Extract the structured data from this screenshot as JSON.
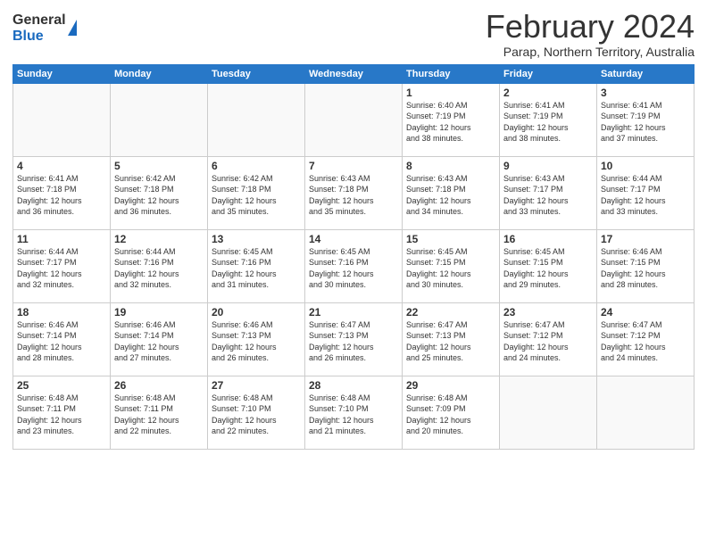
{
  "logo": {
    "general": "General",
    "blue": "Blue"
  },
  "header": {
    "title": "February 2024",
    "subtitle": "Parap, Northern Territory, Australia"
  },
  "weekdays": [
    "Sunday",
    "Monday",
    "Tuesday",
    "Wednesday",
    "Thursday",
    "Friday",
    "Saturday"
  ],
  "weeks": [
    [
      {
        "day": "",
        "info": ""
      },
      {
        "day": "",
        "info": ""
      },
      {
        "day": "",
        "info": ""
      },
      {
        "day": "",
        "info": ""
      },
      {
        "day": "1",
        "info": "Sunrise: 6:40 AM\nSunset: 7:19 PM\nDaylight: 12 hours\nand 38 minutes."
      },
      {
        "day": "2",
        "info": "Sunrise: 6:41 AM\nSunset: 7:19 PM\nDaylight: 12 hours\nand 38 minutes."
      },
      {
        "day": "3",
        "info": "Sunrise: 6:41 AM\nSunset: 7:19 PM\nDaylight: 12 hours\nand 37 minutes."
      }
    ],
    [
      {
        "day": "4",
        "info": "Sunrise: 6:41 AM\nSunset: 7:18 PM\nDaylight: 12 hours\nand 36 minutes."
      },
      {
        "day": "5",
        "info": "Sunrise: 6:42 AM\nSunset: 7:18 PM\nDaylight: 12 hours\nand 36 minutes."
      },
      {
        "day": "6",
        "info": "Sunrise: 6:42 AM\nSunset: 7:18 PM\nDaylight: 12 hours\nand 35 minutes."
      },
      {
        "day": "7",
        "info": "Sunrise: 6:43 AM\nSunset: 7:18 PM\nDaylight: 12 hours\nand 35 minutes."
      },
      {
        "day": "8",
        "info": "Sunrise: 6:43 AM\nSunset: 7:18 PM\nDaylight: 12 hours\nand 34 minutes."
      },
      {
        "day": "9",
        "info": "Sunrise: 6:43 AM\nSunset: 7:17 PM\nDaylight: 12 hours\nand 33 minutes."
      },
      {
        "day": "10",
        "info": "Sunrise: 6:44 AM\nSunset: 7:17 PM\nDaylight: 12 hours\nand 33 minutes."
      }
    ],
    [
      {
        "day": "11",
        "info": "Sunrise: 6:44 AM\nSunset: 7:17 PM\nDaylight: 12 hours\nand 32 minutes."
      },
      {
        "day": "12",
        "info": "Sunrise: 6:44 AM\nSunset: 7:16 PM\nDaylight: 12 hours\nand 32 minutes."
      },
      {
        "day": "13",
        "info": "Sunrise: 6:45 AM\nSunset: 7:16 PM\nDaylight: 12 hours\nand 31 minutes."
      },
      {
        "day": "14",
        "info": "Sunrise: 6:45 AM\nSunset: 7:16 PM\nDaylight: 12 hours\nand 30 minutes."
      },
      {
        "day": "15",
        "info": "Sunrise: 6:45 AM\nSunset: 7:15 PM\nDaylight: 12 hours\nand 30 minutes."
      },
      {
        "day": "16",
        "info": "Sunrise: 6:45 AM\nSunset: 7:15 PM\nDaylight: 12 hours\nand 29 minutes."
      },
      {
        "day": "17",
        "info": "Sunrise: 6:46 AM\nSunset: 7:15 PM\nDaylight: 12 hours\nand 28 minutes."
      }
    ],
    [
      {
        "day": "18",
        "info": "Sunrise: 6:46 AM\nSunset: 7:14 PM\nDaylight: 12 hours\nand 28 minutes."
      },
      {
        "day": "19",
        "info": "Sunrise: 6:46 AM\nSunset: 7:14 PM\nDaylight: 12 hours\nand 27 minutes."
      },
      {
        "day": "20",
        "info": "Sunrise: 6:46 AM\nSunset: 7:13 PM\nDaylight: 12 hours\nand 26 minutes."
      },
      {
        "day": "21",
        "info": "Sunrise: 6:47 AM\nSunset: 7:13 PM\nDaylight: 12 hours\nand 26 minutes."
      },
      {
        "day": "22",
        "info": "Sunrise: 6:47 AM\nSunset: 7:13 PM\nDaylight: 12 hours\nand 25 minutes."
      },
      {
        "day": "23",
        "info": "Sunrise: 6:47 AM\nSunset: 7:12 PM\nDaylight: 12 hours\nand 24 minutes."
      },
      {
        "day": "24",
        "info": "Sunrise: 6:47 AM\nSunset: 7:12 PM\nDaylight: 12 hours\nand 24 minutes."
      }
    ],
    [
      {
        "day": "25",
        "info": "Sunrise: 6:48 AM\nSunset: 7:11 PM\nDaylight: 12 hours\nand 23 minutes."
      },
      {
        "day": "26",
        "info": "Sunrise: 6:48 AM\nSunset: 7:11 PM\nDaylight: 12 hours\nand 22 minutes."
      },
      {
        "day": "27",
        "info": "Sunrise: 6:48 AM\nSunset: 7:10 PM\nDaylight: 12 hours\nand 22 minutes."
      },
      {
        "day": "28",
        "info": "Sunrise: 6:48 AM\nSunset: 7:10 PM\nDaylight: 12 hours\nand 21 minutes."
      },
      {
        "day": "29",
        "info": "Sunrise: 6:48 AM\nSunset: 7:09 PM\nDaylight: 12 hours\nand 20 minutes."
      },
      {
        "day": "",
        "info": ""
      },
      {
        "day": "",
        "info": ""
      }
    ]
  ]
}
